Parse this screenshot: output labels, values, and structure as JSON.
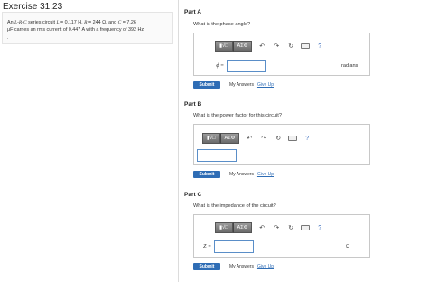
{
  "title": "Exercise 31.23",
  "problem": {
    "line1_prefix": "An ",
    "circuit_type": "L-R-C",
    "line1_mid": " series circuit ",
    "L_symbol": "L",
    "L_value": " = 0.117 H",
    "R_symbol": "R",
    "R_value": " = 244 Ω",
    "C_symbol": "C",
    "C_value": " = 7.26",
    "line2": "μF carries an rms current of 0.447 A with a frequency of 392 Hz",
    "line3": "."
  },
  "parts": [
    {
      "label": "Part A",
      "question": "What is the phase angle?",
      "variable": "ϕ =",
      "unit": "radians",
      "input_value": ""
    },
    {
      "label": "Part B",
      "question": "What is the power factor for this circuit?",
      "variable": "",
      "unit": "",
      "input_value": ""
    },
    {
      "label": "Part C",
      "question": "What is the impedance of the circuit?",
      "variable": "Z =",
      "unit": "Ω",
      "input_value": ""
    }
  ],
  "toolbar": {
    "templates_label": "▮√□",
    "symbols_label": "ΑΣΦ",
    "undo_icon": "↶",
    "redo_icon": "↷",
    "reset_icon": "↻",
    "help_label": "?"
  },
  "actions": {
    "submit_label": "Submit",
    "my_answers_label": "My Answers",
    "give_up_label": "Give Up"
  }
}
